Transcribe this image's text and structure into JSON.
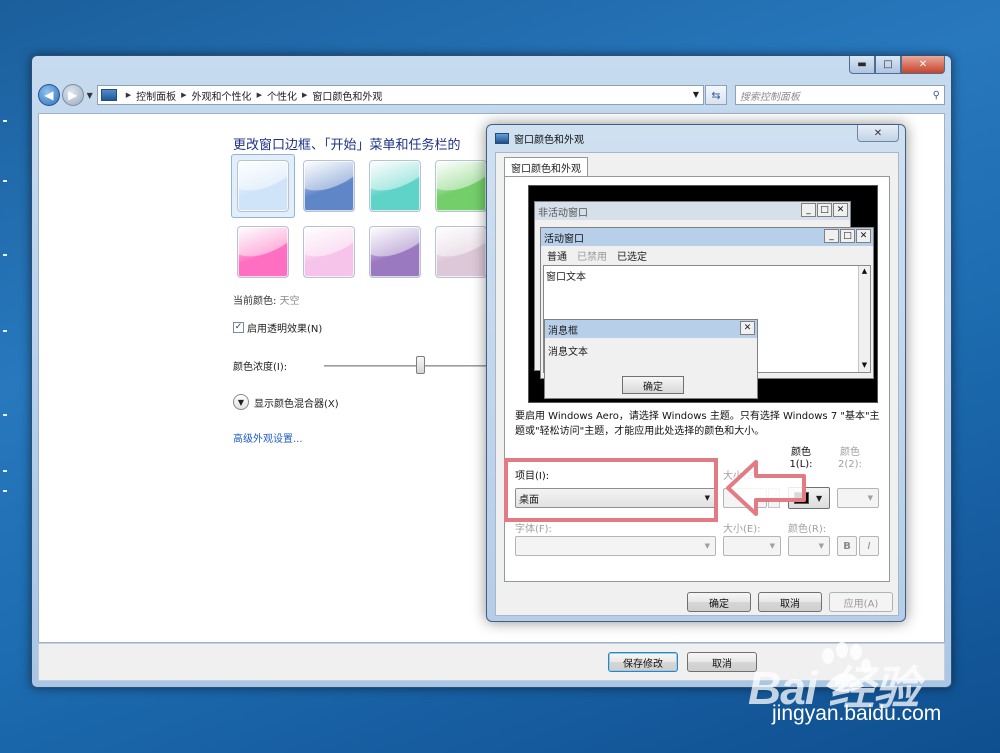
{
  "explorer": {
    "caption_buttons": {
      "minimize": "▬",
      "maximize": "□",
      "close": "✕"
    },
    "nav": {
      "back_icon": "back-arrow-icon",
      "forward_icon": "forward-arrow-icon"
    },
    "breadcrumbs": [
      "控制面板",
      "外观和个性化",
      "个性化",
      "窗口颜色和外观"
    ],
    "search_placeholder": "搜索控制面板",
    "heading": "更改窗口边框、「开始」菜单和任务栏的",
    "swatch_colors": [
      "#cfe4f8",
      "#5f86c7",
      "#5fd3c8",
      "#74cf6a",
      "#ff6fc1",
      "#f6c4ea",
      "#9a79c0",
      "#dcc8d8"
    ],
    "current_color_label": "当前颜色:",
    "current_color_value": "天空",
    "transparency": {
      "label": "启用透明效果(N)",
      "checked": true
    },
    "intensity_label": "颜色浓度(I):",
    "intensity_level": 0.55,
    "mixer_label": "显示颜色混合器(X)",
    "advanced_link": "高级外观设置...",
    "save_button": "保存修改",
    "cancel_button": "取消"
  },
  "dialog": {
    "title": "窗口颜色和外观",
    "close_icon": "✕",
    "tab_label": "窗口颜色和外观",
    "preview": {
      "inactive_title": "非活动窗口",
      "active_title": "活动窗口",
      "menu": {
        "normal": "普通",
        "disabled": "已禁用",
        "selected": "已选定"
      },
      "window_text": "窗口文本",
      "msgbox_title": "消息框",
      "msgbox_text": "消息文本",
      "msgbox_ok": "确定"
    },
    "note": "要启用 Windows Aero，请选择 Windows 主题。只有选择 Windows 7 \"基本\"主题或\"轻松访问\"主题，才能应用此处选择的颜色和大小。",
    "item_label": "项目(I):",
    "item_value": "桌面",
    "size_label": "大小(Z):",
    "color1_label": "颜色 1(L):",
    "color2_label": "颜色 2(2):",
    "font_label": "字体(F):",
    "font_size_label": "大小(E):",
    "font_color_label": "颜色(R):",
    "bold": "B",
    "italic": "I",
    "ok": "确定",
    "cancel": "取消",
    "apply": "应用(A)"
  },
  "watermark": {
    "logo": "Bai 经验",
    "url": "jingyan.baidu.com"
  },
  "colors": {
    "highlight": "#e37b85",
    "link": "#1e5ec8",
    "heading": "#1e3287"
  }
}
